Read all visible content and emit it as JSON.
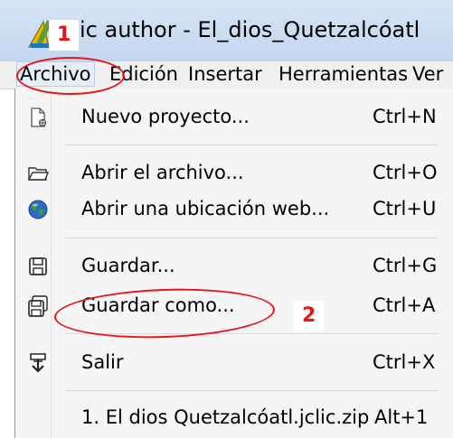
{
  "window": {
    "title": "ic author - El_dios_Quetzalcóatl"
  },
  "annotations": {
    "step1": "1",
    "step2": "2"
  },
  "menubar": {
    "items": [
      "Archivo",
      "Edición",
      "Insertar",
      "Herramientas",
      "Ver"
    ]
  },
  "menu": {
    "nuevo": {
      "label": "Nuevo proyecto...",
      "shortcut": "Ctrl+N"
    },
    "abrir": {
      "label": "Abrir el archivo...",
      "shortcut": "Ctrl+O"
    },
    "abrir_web": {
      "label": "Abrir una ubicación web...",
      "shortcut": "Ctrl+U"
    },
    "guardar": {
      "label": "Guardar...",
      "shortcut": "Ctrl+G"
    },
    "guardar_como": {
      "label": "Guardar como...",
      "shortcut": "Ctrl+A"
    },
    "salir": {
      "label": "Salir",
      "shortcut": "Ctrl+X"
    },
    "recent": {
      "label": "1. El dios Quetzalcóatl.jclic.zip",
      "shortcut": "Alt+1"
    }
  },
  "colors": {
    "annotation": "#e4161b",
    "menu_bg": "#f5f5f5",
    "titlebar": "#c9dbf0"
  }
}
